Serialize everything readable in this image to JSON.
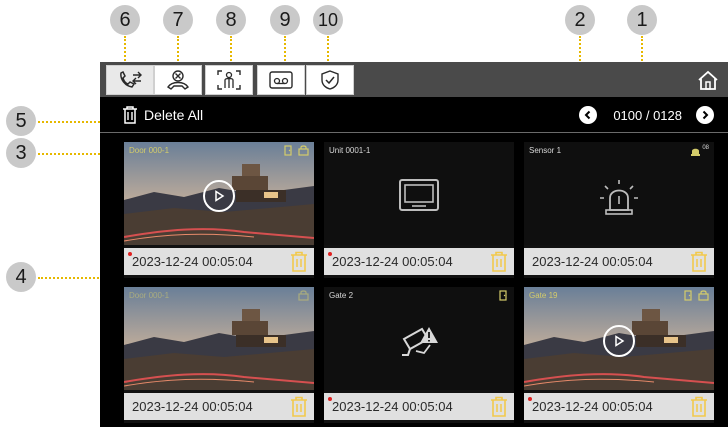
{
  "callouts": [
    "6",
    "7",
    "8",
    "9",
    "10",
    "2",
    "1",
    "5",
    "3",
    "4"
  ],
  "toolbar": {
    "tabs": [
      {
        "icon": "call-transfer-icon",
        "active": true
      },
      {
        "icon": "missed-call-icon",
        "active": false
      },
      {
        "icon": "person-snapshot-icon",
        "active": false
      },
      {
        "icon": "voicemail-icon",
        "active": false
      },
      {
        "icon": "shield-check-icon",
        "active": false
      }
    ],
    "home_icon": "home-icon"
  },
  "delete_all_label": "Delete All",
  "pager": {
    "count": "0100 / 0128"
  },
  "records": [
    {
      "title": "Door 000-1",
      "timestamp": "2023-12-24  00:05:04",
      "kind": "photo-video",
      "unread": true
    },
    {
      "title": "Unit 0001-1",
      "timestamp": "2023-12-24  00:05:04",
      "kind": "indoor-monitor",
      "unread": true
    },
    {
      "title": "Sensor 1",
      "timestamp": "2023-12-24  00:05:04",
      "kind": "alarm",
      "badge": "08",
      "unread": false
    },
    {
      "title": "Door 000-1",
      "timestamp": "2023-12-24  00:05:04",
      "kind": "photo",
      "unread": false
    },
    {
      "title": "Gate 2",
      "timestamp": "2023-12-24  00:05:04",
      "kind": "camera-alert",
      "unread": true
    },
    {
      "title": "Gate 19",
      "timestamp": "2023-12-24  00:05:04",
      "kind": "photo-video",
      "unread": true
    }
  ],
  "colors": {
    "accent_yellow": "#e6b800",
    "bin_yellow": "#f2c94c",
    "bar": "#4a4a4a"
  }
}
